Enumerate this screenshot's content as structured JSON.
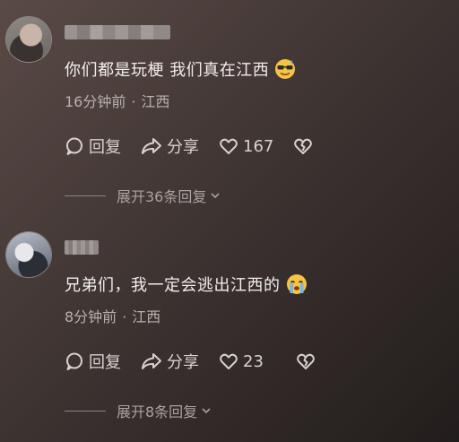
{
  "comments": [
    {
      "text": "你们都是玩梗 我们真在江西",
      "emoji": "sunglasses-sweat-emoji",
      "time": "16分钟前",
      "separator": "·",
      "location": "江西",
      "reply_label": "回复",
      "share_label": "分享",
      "like_count": "167",
      "expand_label": "展开36条回复"
    },
    {
      "text": "兄弟们，我一定会逃出江西的",
      "emoji": "crying-emoji",
      "time": "8分钟前",
      "separator": "·",
      "location": "江西",
      "reply_label": "回复",
      "share_label": "分享",
      "like_count": "23",
      "expand_label": "展开8条回复"
    }
  ],
  "colors": {
    "text": "#f1eeec",
    "meta": "#b8b1ae",
    "emoji_face": "#f6c342"
  }
}
